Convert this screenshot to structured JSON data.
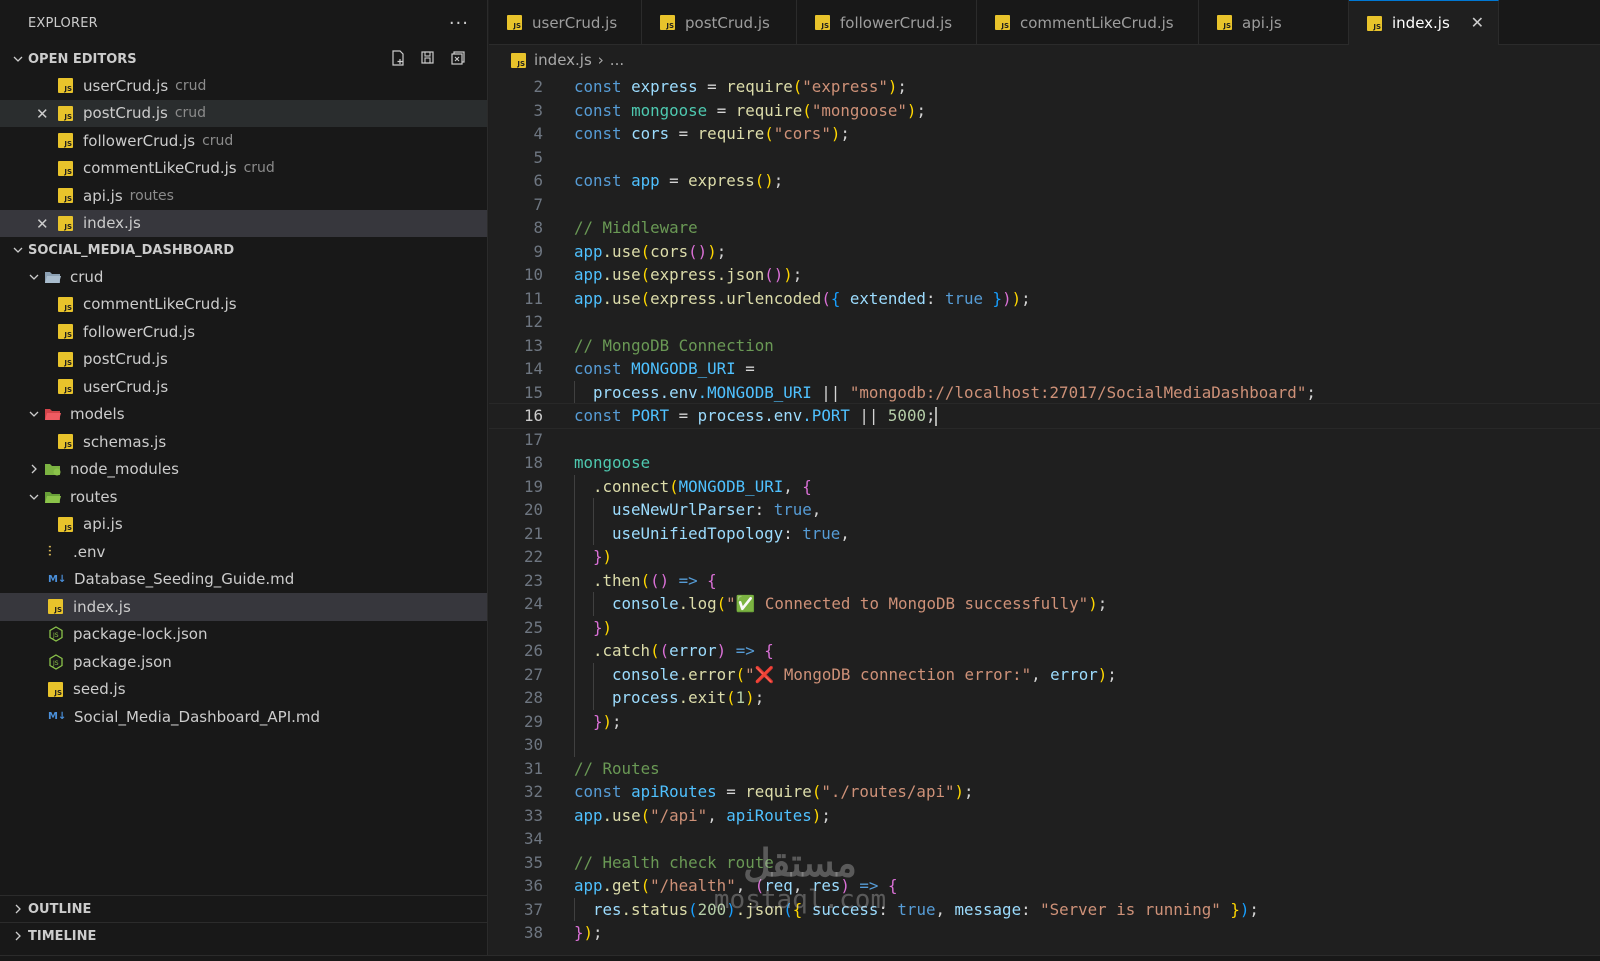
{
  "explorer": {
    "title": "EXPLORER",
    "more": "···"
  },
  "open_editors": {
    "header": "OPEN EDITORS",
    "items": [
      {
        "name": "userCrud.js",
        "desc": "crud"
      },
      {
        "name": "postCrud.js",
        "desc": "crud"
      },
      {
        "name": "followerCrud.js",
        "desc": "crud"
      },
      {
        "name": "commentLikeCrud.js",
        "desc": "crud"
      },
      {
        "name": "api.js",
        "desc": "routes"
      },
      {
        "name": "index.js",
        "desc": ""
      }
    ]
  },
  "project": {
    "header": "SOCIAL_MEDIA_DASHBOARD",
    "tree": [
      {
        "name": "crud",
        "kind": "folder"
      },
      {
        "name": "commentLikeCrud.js",
        "kind": "js"
      },
      {
        "name": "followerCrud.js",
        "kind": "js"
      },
      {
        "name": "postCrud.js",
        "kind": "js"
      },
      {
        "name": "userCrud.js",
        "kind": "js"
      },
      {
        "name": "models",
        "kind": "folder"
      },
      {
        "name": "schemas.js",
        "kind": "js"
      },
      {
        "name": "node_modules",
        "kind": "folder"
      },
      {
        "name": "routes",
        "kind": "folder"
      },
      {
        "name": "api.js",
        "kind": "js"
      },
      {
        "name": ".env",
        "kind": "env"
      },
      {
        "name": "Database_Seeding_Guide.md",
        "kind": "md"
      },
      {
        "name": "index.js",
        "kind": "js"
      },
      {
        "name": "package-lock.json",
        "kind": "json"
      },
      {
        "name": "package.json",
        "kind": "json"
      },
      {
        "name": "seed.js",
        "kind": "js"
      },
      {
        "name": "Social_Media_Dashboard_API.md",
        "kind": "md"
      }
    ]
  },
  "outline": {
    "header": "OUTLINE"
  },
  "timeline": {
    "header": "TIMELINE"
  },
  "tabs": [
    {
      "label": "userCrud.js"
    },
    {
      "label": "postCrud.js"
    },
    {
      "label": "followerCrud.js"
    },
    {
      "label": "commentLikeCrud.js"
    },
    {
      "label": "api.js"
    },
    {
      "label": "index.js"
    }
  ],
  "breadcrumb": {
    "file": "index.js",
    "rest": "..."
  },
  "editor": {
    "current_line": 16,
    "line_numbers": [
      "2",
      "3",
      "4",
      "5",
      "6",
      "7",
      "8",
      "9",
      "10",
      "11",
      "12",
      "13",
      "14",
      "15",
      "16",
      "17",
      "18",
      "19",
      "20",
      "21",
      "22",
      "23",
      "24",
      "25",
      "26",
      "27",
      "28",
      "29",
      "30",
      "31",
      "32",
      "33",
      "34",
      "35",
      "36",
      "37",
      "38"
    ],
    "tokens": {
      "l2": [
        "const",
        "express",
        "=",
        "require",
        "(",
        "\"express\"",
        ")",
        ";"
      ],
      "l3": [
        "const",
        "mongoose",
        "=",
        "require",
        "(",
        "\"mongoose\"",
        ")",
        ";"
      ],
      "l4": [
        "const",
        "cors",
        "=",
        "require",
        "(",
        "\"cors\"",
        ")",
        ";"
      ],
      "l6": [
        "const",
        "app",
        "=",
        "express",
        "()",
        ";"
      ],
      "l8": "// Middleware",
      "l9": [
        "app",
        ".use",
        "(",
        "cors",
        "()",
        ")",
        ";"
      ],
      "l10": [
        "app",
        ".use",
        "(",
        "express",
        ".json",
        "()",
        ")",
        ";"
      ],
      "l11": [
        "app",
        ".use",
        "(",
        "express",
        ".urlencoded",
        "(",
        "{",
        "extended",
        ":",
        "true",
        "}",
        ")",
        ")",
        ";"
      ],
      "l13": "// MongoDB Connection",
      "l14": [
        "const",
        "MONGODB_URI",
        "="
      ],
      "l15": [
        "process",
        ".env",
        ".MONGODB_URI",
        "||",
        "\"mongodb://localhost:27017/SocialMediaDashboard\"",
        ";"
      ],
      "l16": [
        "const",
        "PORT",
        "=",
        "process",
        ".env",
        ".PORT",
        "||",
        "5000",
        ";"
      ],
      "l18": "mongoose",
      "l19": [
        ".connect",
        "(",
        "MONGODB_URI",
        ",",
        "{"
      ],
      "l20": [
        "useNewUrlParser",
        ":",
        "true",
        ","
      ],
      "l21": [
        "useUnifiedTopology",
        ":",
        "true",
        ","
      ],
      "l22": [
        "}",
        ")"
      ],
      "l23": [
        ".then",
        "(",
        "()",
        "=>",
        "{"
      ],
      "l24": [
        "console",
        ".log",
        "(",
        "\"✅ Connected to MongoDB successfully\"",
        ")",
        ";"
      ],
      "l25": [
        "}",
        ")"
      ],
      "l26": [
        ".catch",
        "(",
        "(",
        "error",
        ")",
        "=>",
        "{"
      ],
      "l27": [
        "console",
        ".error",
        "(",
        "\"❌ MongoDB connection error:\"",
        ",",
        "error",
        ")",
        ";"
      ],
      "l28": [
        "process",
        ".exit",
        "(",
        "1",
        ")",
        ";"
      ],
      "l29": [
        "}",
        ")",
        ";"
      ],
      "l31": "// Routes",
      "l32": [
        "const",
        "apiRoutes",
        "=",
        "require",
        "(",
        "\"./routes/api\"",
        ")",
        ";"
      ],
      "l33": [
        "app",
        ".use",
        "(",
        "\"/api\"",
        ",",
        "apiRoutes",
        ")",
        ";"
      ],
      "l35": "// Health check route",
      "l36": [
        "app",
        ".get",
        "(",
        "\"/health\"",
        ",",
        "(",
        "req",
        ",",
        "res",
        ")",
        "=>",
        "{"
      ],
      "l37": [
        "res",
        ".status",
        "(",
        "200",
        ")",
        ".json",
        "(",
        "{",
        "success",
        ":",
        "true",
        ",",
        "message",
        ":",
        "\"Server is running\"",
        "}",
        ")",
        ";"
      ],
      "l38": [
        "}",
        ")",
        ";"
      ]
    }
  },
  "watermark": {
    "arabic": "مستقل",
    "latin": "mostaql.com"
  },
  "colors": {
    "js_icon": "#e8c32b",
    "accent": "#0078d4",
    "keyword": "#569cd6",
    "string": "#ce9178",
    "comment": "#6a9955"
  }
}
